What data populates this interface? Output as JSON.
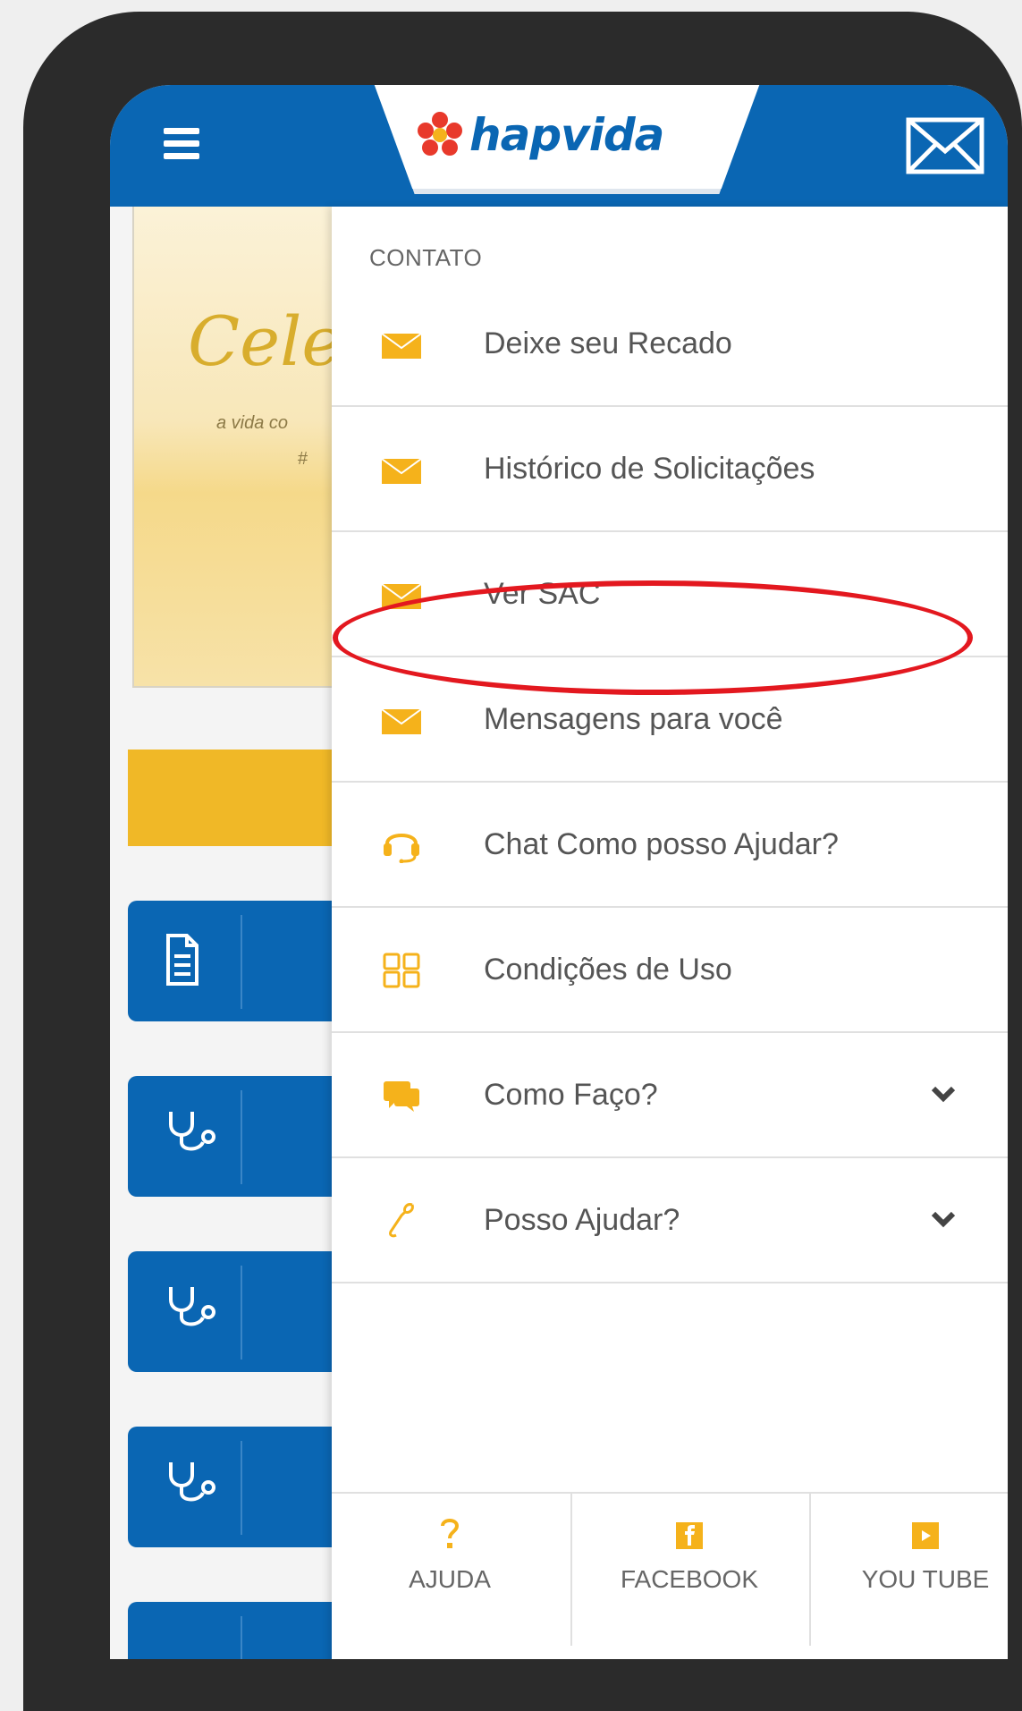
{
  "header": {
    "logo_text": "hapvida",
    "brand_color": "#0a66b3",
    "accent_color": "#f0b827"
  },
  "background": {
    "banner_title": "Cele",
    "banner_subtitle": "a vida co",
    "banner_hash": "#"
  },
  "drawer": {
    "section_title": "CONTATO",
    "items": [
      {
        "label": "Deixe seu Recado",
        "icon": "envelope-icon"
      },
      {
        "label": "Histórico de Solicitações",
        "icon": "envelope-icon"
      },
      {
        "label": "Ver SAC",
        "icon": "envelope-icon"
      },
      {
        "label": "Mensagens para você",
        "icon": "envelope-icon"
      },
      {
        "label": "Chat Como posso Ajudar?",
        "icon": "headset-icon"
      },
      {
        "label": "Condições de Uso",
        "icon": "grid-icon"
      },
      {
        "label": "Como Faço?",
        "icon": "chat-bubbles-icon",
        "expandable": true
      },
      {
        "label": "Posso Ajudar?",
        "icon": "phone-icon",
        "expandable": true
      }
    ],
    "highlighted_item": "Ver SAC",
    "highlight_color": "#e3181f"
  },
  "bottom_bar": {
    "items": [
      {
        "label": "AJUDA",
        "icon": "question-icon"
      },
      {
        "label": "FACEBOOK",
        "icon": "facebook-icon"
      },
      {
        "label": "YOU TUBE",
        "icon": "youtube-icon"
      }
    ]
  }
}
